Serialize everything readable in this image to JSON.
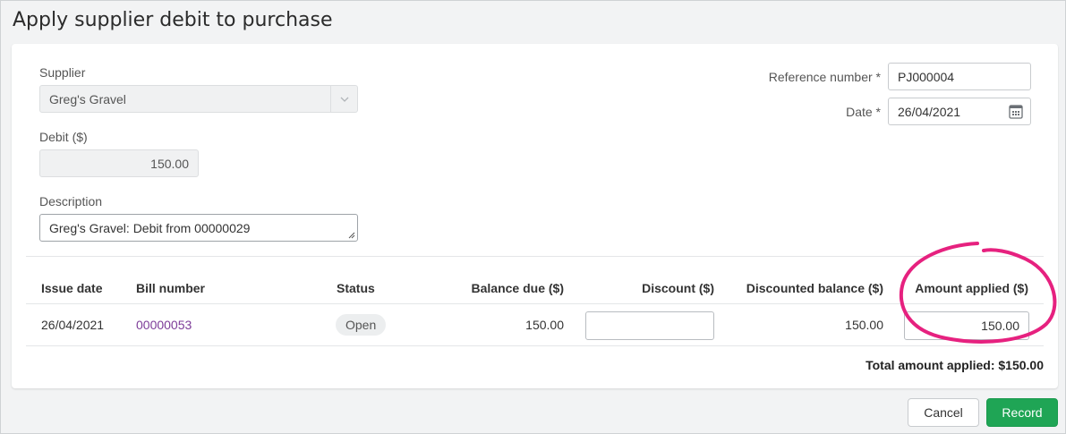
{
  "page": {
    "title": "Apply supplier debit to purchase"
  },
  "form": {
    "supplier_label": "Supplier",
    "supplier_value": "Greg's Gravel",
    "debit_label": "Debit ($)",
    "debit_value": "150.00",
    "description_label": "Description",
    "description_value": "Greg's Gravel: Debit from 00000029",
    "reference_label": "Reference number *",
    "reference_value": "PJ000004",
    "date_label": "Date *",
    "date_value": "26/04/2021"
  },
  "table": {
    "headers": [
      "Issue date",
      "Bill number",
      "Status",
      "Balance due ($)",
      "Discount ($)",
      "Discounted balance ($)",
      "Amount applied ($)"
    ],
    "rows": [
      {
        "issue_date": "26/04/2021",
        "bill_number": "00000053",
        "status": "Open",
        "balance_due": "150.00",
        "discount": "",
        "discounted_balance": "150.00",
        "amount_applied": "150.00"
      }
    ],
    "total": "Total amount applied: $150.00"
  },
  "actions": {
    "cancel_label": "Cancel",
    "record_label": "Record"
  },
  "colors": {
    "record": "#1fa555",
    "link": "#7d3c98",
    "highlight": "#e6217f"
  },
  "icons": [
    "chevron-down-icon",
    "calendar-icon",
    "resize-grip-icon"
  ]
}
